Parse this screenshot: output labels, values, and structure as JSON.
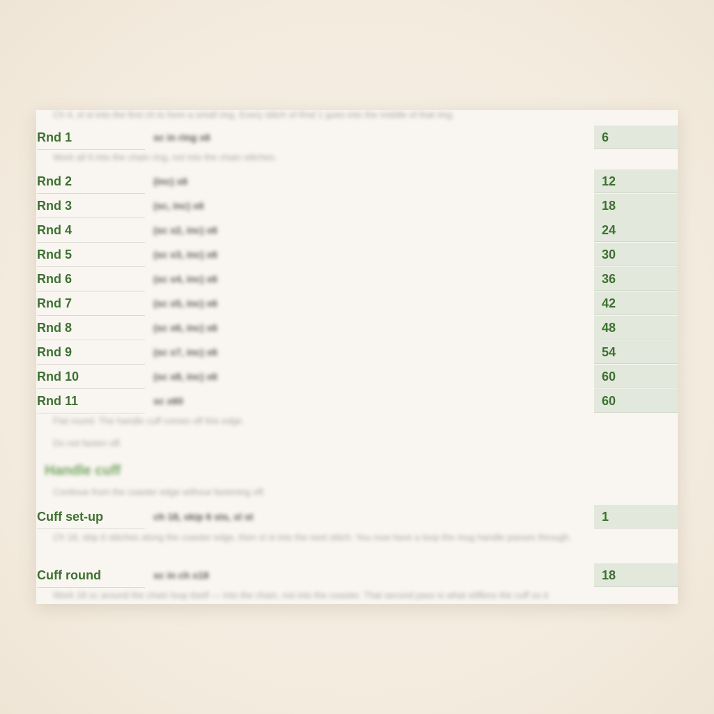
{
  "notes": {
    "top": "Ch 4, sl st into the first ch to form a small ring. Every stitch of Rnd 1 goes into the middle of that ring.",
    "after_rnd1": "Work all 6 into the chain ring, not into the chain stitches.",
    "after_rnd11_a": "Flat round. The handle cuff comes off this edge.",
    "after_rnd11_b": "Do not fasten off.",
    "cuff_intro": "Continue from the coaster edge without fastening off.",
    "after_setup": "Ch 18, skip 6 stitches along the coaster edge, then sl st into the next stitch. You now have a loop the mug handle passes through.",
    "after_cuff_round": "Work 18 sc around the chain loop itself — into the chain, not into the coaster. That second pass is what stiffens the cuff so it"
  },
  "section": {
    "heading": "Handle cuff"
  },
  "rows": [
    {
      "label": "Rnd 1",
      "instr": "sc in ring x6",
      "count": "6"
    },
    {
      "label": "Rnd 2",
      "instr": "(inc) x6",
      "count": "12"
    },
    {
      "label": "Rnd 3",
      "instr": "(sc, inc) x6",
      "count": "18"
    },
    {
      "label": "Rnd 4",
      "instr": "(sc x2, inc) x6",
      "count": "24"
    },
    {
      "label": "Rnd 5",
      "instr": "(sc x3, inc) x6",
      "count": "30"
    },
    {
      "label": "Rnd 6",
      "instr": "(sc x4, inc) x6",
      "count": "36"
    },
    {
      "label": "Rnd 7",
      "instr": "(sc x5, inc) x6",
      "count": "42"
    },
    {
      "label": "Rnd 8",
      "instr": "(sc x6, inc) x6",
      "count": "48"
    },
    {
      "label": "Rnd 9",
      "instr": "(sc x7, inc) x6",
      "count": "54"
    },
    {
      "label": "Rnd 10",
      "instr": "(sc x8, inc) x6",
      "count": "60"
    },
    {
      "label": "Rnd 11",
      "instr": "sc x60",
      "count": "60"
    },
    {
      "label": "Cuff set-up",
      "instr": "ch 18, skip 6 sts, sl st",
      "count": "1"
    },
    {
      "label": "Cuff round",
      "instr": "sc in ch x18",
      "count": "18"
    }
  ]
}
